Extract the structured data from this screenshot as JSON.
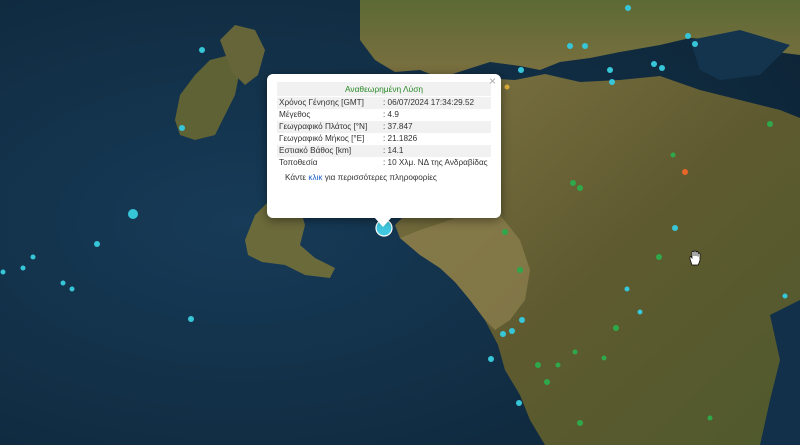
{
  "popup": {
    "title": "Αναθεωρημένη Λύση",
    "close_icon": "close-icon",
    "rows": [
      {
        "label": "Χρόνος Γένησης [GMT]",
        "value": ": 06/07/2024 17:34:29.52"
      },
      {
        "label": "Μέγεθος",
        "value": ": 4.9"
      },
      {
        "label": "Γεωγραφικό Πλάτος [°N]",
        "value": ": 37.847"
      },
      {
        "label": "Γεωγραφικό Μήκος [°E]",
        "value": ": 21.1826"
      },
      {
        "label": "Εστιακό Βάθος [km]",
        "value": ": 14.1"
      },
      {
        "label": "Τοποθεσία",
        "value": ": 10 Χλμ. ΝΔ της Ανδραβίδας"
      }
    ],
    "more_prefix": "Κάντε ",
    "more_link": "κλικ",
    "more_suffix": " για περισσότερες πληροφορίες"
  },
  "map": {
    "marker_colors": {
      "cyan": "#37c6d8",
      "green": "#2ea84a",
      "orange": "#e8662a",
      "selected": "#41c8e0"
    },
    "sea_color": "#12304a",
    "land_color": "#6b6436",
    "cursor_icon": "hand-cursor-icon"
  }
}
